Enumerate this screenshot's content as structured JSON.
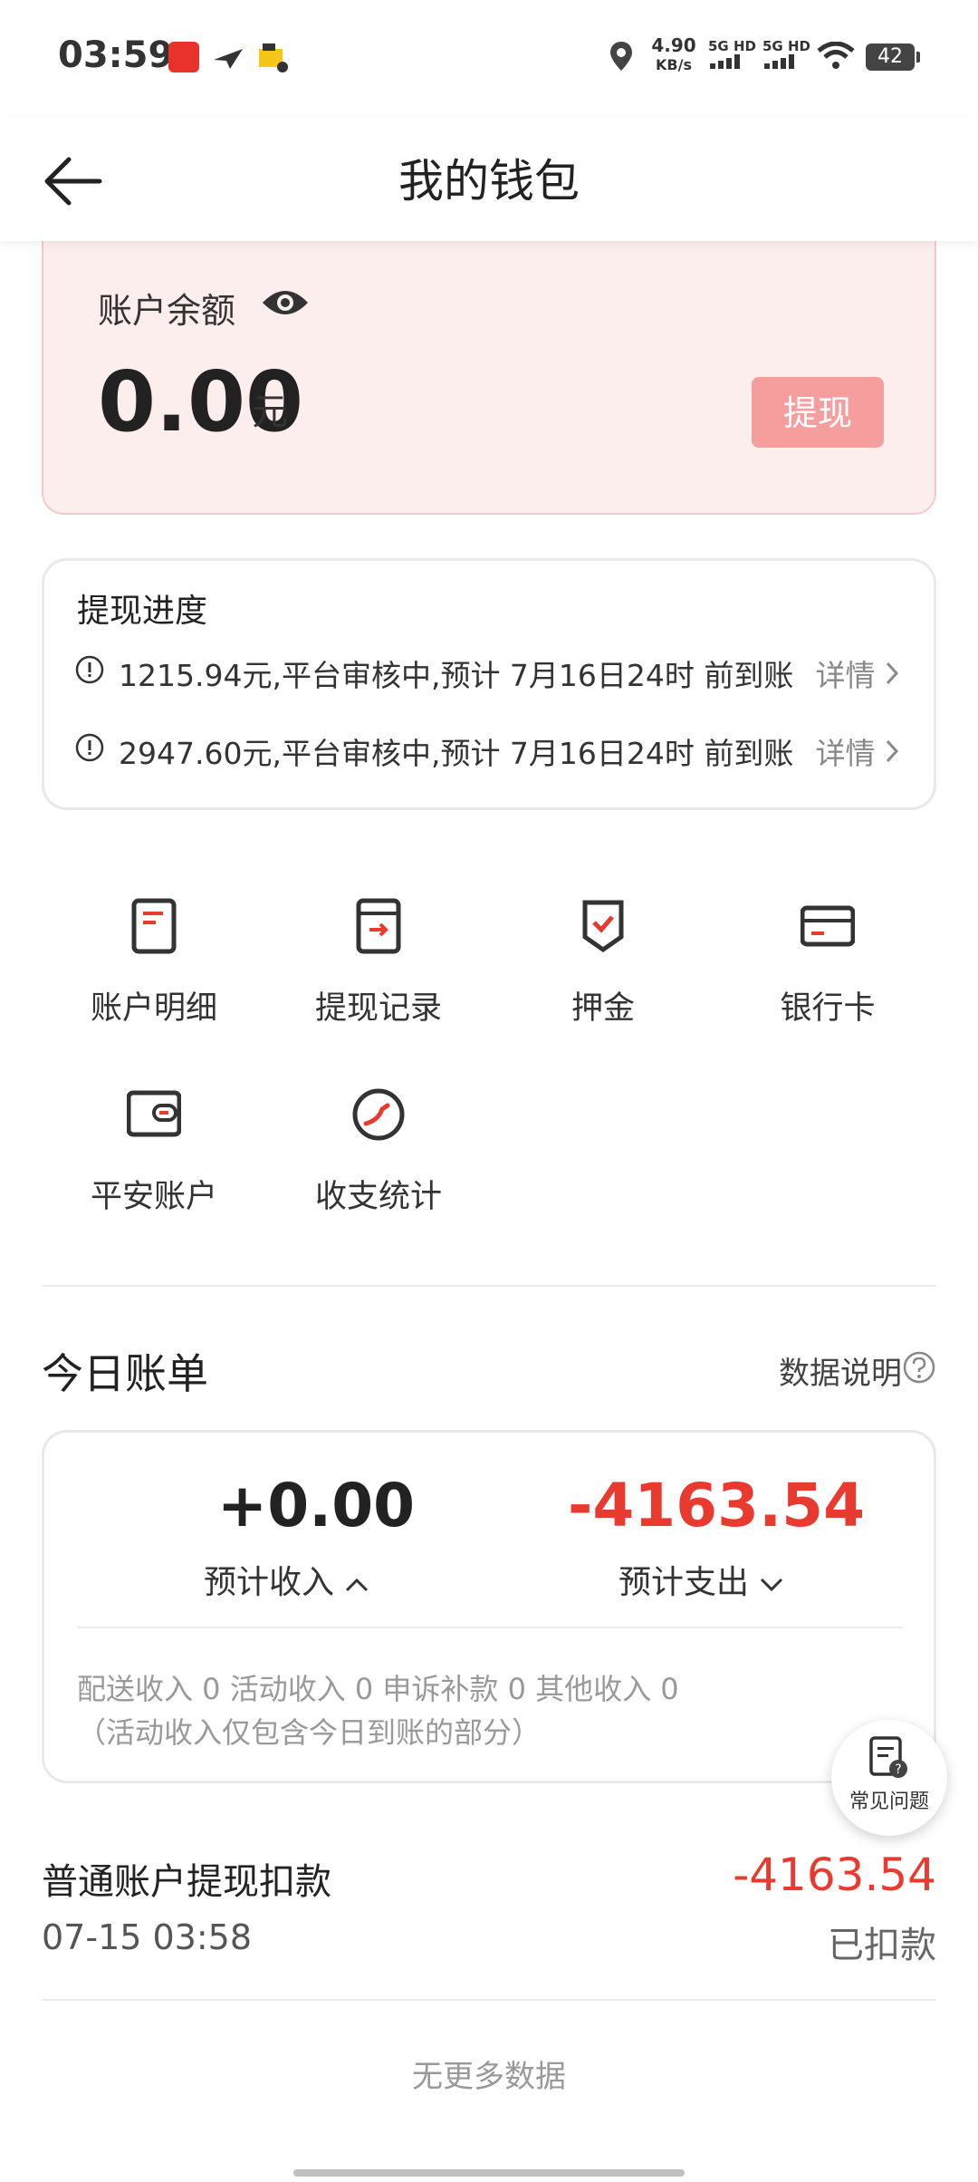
{
  "status_bar": {
    "time": "03:59",
    "net_speed_value": "4.90",
    "net_speed_unit": "KB/s",
    "net1": "5G HD",
    "net2": "5G HD",
    "battery": "42",
    "icons": [
      "app-notify-icon",
      "plane-icon",
      "delivery-icon",
      "location-icon",
      "signal-icon",
      "wifi-icon"
    ]
  },
  "header": {
    "title": "我的钱包"
  },
  "balance": {
    "label": "账户余额",
    "amount": "0.00",
    "unit": "元",
    "withdraw_label": "提现"
  },
  "progress": {
    "title": "提现进度",
    "rows": [
      {
        "text": "1215.94元,平台审核中,预计 7月16日24时 前到账",
        "detail": "详情"
      },
      {
        "text": "2947.60元,平台审核中,预计 7月16日24时 前到账",
        "detail": "详情"
      }
    ]
  },
  "grid": [
    {
      "label": "账户明细"
    },
    {
      "label": "提现记录"
    },
    {
      "label": "押金"
    },
    {
      "label": "银行卡"
    },
    {
      "label": "平安账户"
    },
    {
      "label": "收支统计"
    }
  ],
  "today_bill": {
    "title": "今日账单",
    "data_note": "数据说明",
    "income": "+0.00",
    "income_label": "预计收入",
    "expense": "-4163.54",
    "expense_label": "预计支出",
    "note1": "配送收入 0 活动收入 0 申诉补款 0 其他收入 0",
    "note2": "（活动收入仅包含今日到账的部分）"
  },
  "faq": {
    "label": "常见问题"
  },
  "record": {
    "title": "普通账户提现扣款",
    "time": "07-15 03:58",
    "amount": "-4163.54",
    "status": "已扣款"
  },
  "footer": {
    "no_more": "无更多数据"
  },
  "colors": {
    "accent_red": "#e93a30",
    "card_pink": "#fdeeee",
    "button_pink": "#f69d9d"
  }
}
